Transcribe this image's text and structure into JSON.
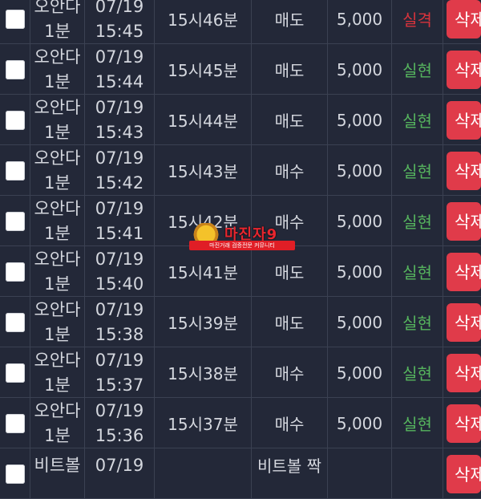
{
  "rows": [
    {
      "game": [
        "오안다",
        "1분"
      ],
      "date": "07/19",
      "time": "15:45",
      "round": "15시46분",
      "bet": "매도",
      "amount": "5,000",
      "result": "실격",
      "result_status": "fail",
      "action": "삭제"
    },
    {
      "game": [
        "오안다",
        "1분"
      ],
      "date": "07/19",
      "time": "15:44",
      "round": "15시45분",
      "bet": "매도",
      "amount": "5,000",
      "result": "실현",
      "result_status": "ok",
      "action": "삭제"
    },
    {
      "game": [
        "오안다",
        "1분"
      ],
      "date": "07/19",
      "time": "15:43",
      "round": "15시44분",
      "bet": "매도",
      "amount": "5,000",
      "result": "실현",
      "result_status": "ok",
      "action": "삭제"
    },
    {
      "game": [
        "오안다",
        "1분"
      ],
      "date": "07/19",
      "time": "15:42",
      "round": "15시43분",
      "bet": "매수",
      "amount": "5,000",
      "result": "실현",
      "result_status": "ok",
      "action": "삭제"
    },
    {
      "game": [
        "오안다",
        "1분"
      ],
      "date": "07/19",
      "time": "15:41",
      "round": "15시42분",
      "bet": "매수",
      "amount": "5,000",
      "result": "실현",
      "result_status": "ok",
      "action": "삭제"
    },
    {
      "game": [
        "오안다",
        "1분"
      ],
      "date": "07/19",
      "time": "15:40",
      "round": "15시41분",
      "bet": "매도",
      "amount": "5,000",
      "result": "실현",
      "result_status": "ok",
      "action": "삭제"
    },
    {
      "game": [
        "오안다",
        "1분"
      ],
      "date": "07/19",
      "time": "15:38",
      "round": "15시39분",
      "bet": "매도",
      "amount": "5,000",
      "result": "실현",
      "result_status": "ok",
      "action": "삭제"
    },
    {
      "game": [
        "오안다",
        "1분"
      ],
      "date": "07/19",
      "time": "15:37",
      "round": "15시38분",
      "bet": "매수",
      "amount": "5,000",
      "result": "실현",
      "result_status": "ok",
      "action": "삭제"
    },
    {
      "game": [
        "오안다",
        "1분"
      ],
      "date": "07/19",
      "time": "15:36",
      "round": "15시37분",
      "bet": "매수",
      "amount": "5,000",
      "result": "실현",
      "result_status": "ok",
      "action": "삭제"
    },
    {
      "game": [
        "비트볼",
        ""
      ],
      "date": "07/19",
      "time": "",
      "round": "",
      "bet": "비트볼 짝",
      "amount": "",
      "result": "",
      "result_status": "ok",
      "action": "삭제"
    }
  ],
  "watermark": {
    "title": "마진자9",
    "tagline": "마진거래 검증전문 커뮤니티"
  },
  "colors": {
    "background": "#232838",
    "fail": "#d8333c",
    "ok": "#56b55e",
    "delete_button": "#e03b4a"
  }
}
